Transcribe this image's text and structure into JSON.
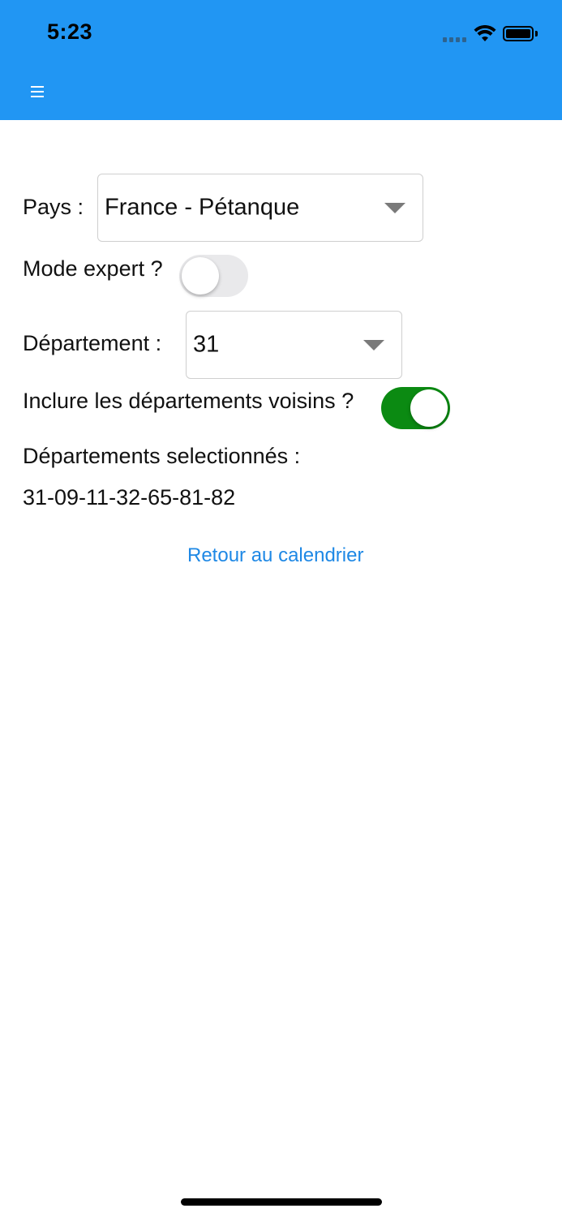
{
  "status_bar": {
    "time": "5:23"
  },
  "header": {
    "menu_icon": "hamburger-menu-icon",
    "background_color": "#2196f3"
  },
  "form": {
    "country_label": "Pays :",
    "country_value": "France - Pétanque",
    "expert_mode_label": "Mode expert ?",
    "expert_mode_on": false,
    "department_label": "Département :",
    "department_value": "31",
    "include_neighbors_label": "Inclure les départements voisins ?",
    "include_neighbors_on": true,
    "selected_label": "Départements selectionnés :",
    "selected_value": "31-09-11-32-65-81-82",
    "back_link": "Retour au calendrier"
  },
  "colors": {
    "toggle_on": "#0b8a12",
    "link": "#1e88e5"
  }
}
